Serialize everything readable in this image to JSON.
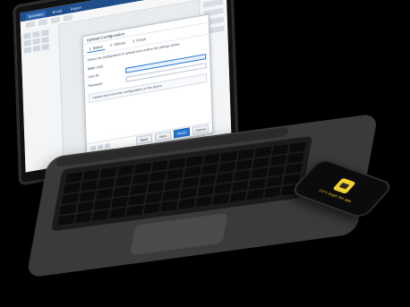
{
  "app": {
    "tabs": [
      "Summary",
      "Enroll",
      "Report"
    ]
  },
  "dialog": {
    "title": "Upload Configuration",
    "tabs": [
      "1. Select",
      "2. Upload",
      "3. Finish"
    ],
    "desc": "Select the configuration to upload and confirm the settings below.",
    "section_label": "Main Unit",
    "fields": [
      {
        "label": "User ID",
        "value": ""
      },
      {
        "label": "Password",
        "value": ""
      }
    ],
    "note": "Upload and overwrite configuration on the device.",
    "buttons": [
      "Back",
      "Next",
      "Finish",
      "Cancel"
    ]
  },
  "phone": {
    "label": "Let's begin the app"
  }
}
